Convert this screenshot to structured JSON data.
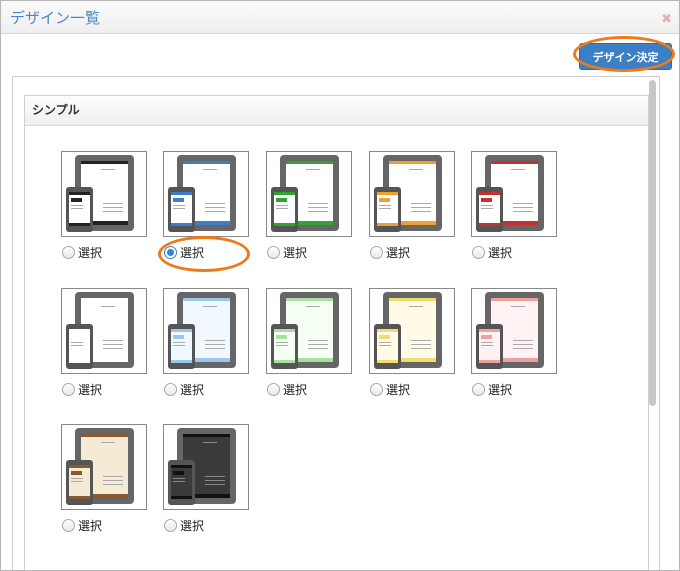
{
  "dialog": {
    "title": "デザイン一覧",
    "close_glyph": "✖",
    "decide_button": "デザイン決定"
  },
  "section": {
    "title": "シンプル"
  },
  "designs": [
    {
      "label": "選択",
      "selected": false,
      "bar": "#222222",
      "bg": "#ffffff",
      "phone_bar": "#222222"
    },
    {
      "label": "選択",
      "selected": true,
      "bar": "#3d7fc5",
      "bg": "#ffffff",
      "phone_bar": "#3d7fc5"
    },
    {
      "label": "選択",
      "selected": false,
      "bar": "#2ea52e",
      "bg": "#ffffff",
      "phone_bar": "#2ea52e"
    },
    {
      "label": "選択",
      "selected": false,
      "bar": "#f0a030",
      "bg": "#ffffff",
      "phone_bar": "#f0a030"
    },
    {
      "label": "選択",
      "selected": false,
      "bar": "#c83030",
      "bg": "#ffffff",
      "phone_bar": "#c83030"
    },
    {
      "label": "選択",
      "selected": false,
      "bar": "#ffffff",
      "bg": "#ffffff",
      "phone_bar": "#ffffff"
    },
    {
      "label": "選択",
      "selected": false,
      "bar": "#9cc6ee",
      "bg": "#f2f8ff",
      "phone_bar": "#9cc6ee"
    },
    {
      "label": "選択",
      "selected": false,
      "bar": "#a8e0a0",
      "bg": "#f6fff4",
      "phone_bar": "#a8e0a0"
    },
    {
      "label": "選択",
      "selected": false,
      "bar": "#f0dc70",
      "bg": "#fffbe6",
      "phone_bar": "#f0dc70"
    },
    {
      "label": "選択",
      "selected": false,
      "bar": "#f0a0a0",
      "bg": "#fff2f2",
      "phone_bar": "#f0a0a0"
    },
    {
      "label": "選択",
      "selected": false,
      "bar": "#8a5a2e",
      "bg": "#f5ead4",
      "phone_bar": "#8a5a2e"
    },
    {
      "label": "選択",
      "selected": false,
      "bar": "#111111",
      "bg": "#3a3a3a",
      "phone_bar": "#111111"
    }
  ]
}
